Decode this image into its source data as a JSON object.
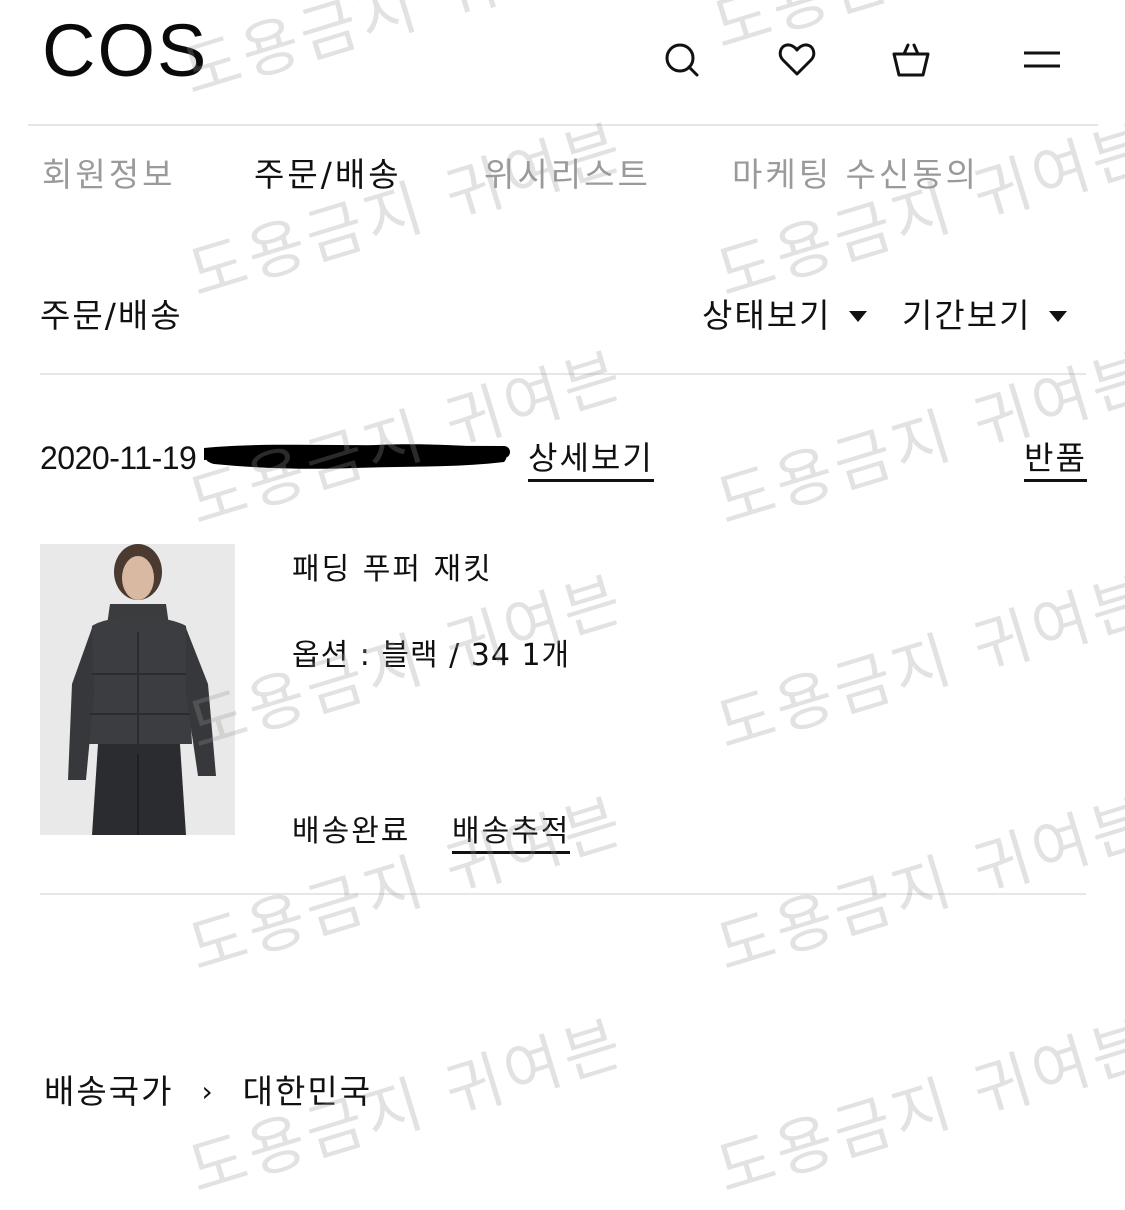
{
  "header": {
    "logo": "COS",
    "icons": [
      "search-icon",
      "heart-icon",
      "basket-icon",
      "menu-icon"
    ]
  },
  "tabs": [
    "회원정보",
    "주문/배송",
    "위시리스트",
    "마케팅 수신동의"
  ],
  "active_tab": "주문/배송",
  "section": {
    "title": "주문/배송",
    "status_filter": "상태보기",
    "period_filter": "기간보기"
  },
  "order": {
    "date": "2020-11-19",
    "detail_link": "상세보기",
    "return_link": "반품",
    "product": {
      "name": "패딩 푸퍼 재킷",
      "option": "옵션 : 블랙 / 34 1개"
    },
    "status": "배송완료",
    "tracking_link": "배송추적"
  },
  "footer": {
    "label": "배송국가",
    "value": "대한민국"
  },
  "watermark": "도용금지 귀여븐",
  "colors": {
    "text": "#111111",
    "muted": "#9a9a9a",
    "rule": "#e6e6e6"
  }
}
